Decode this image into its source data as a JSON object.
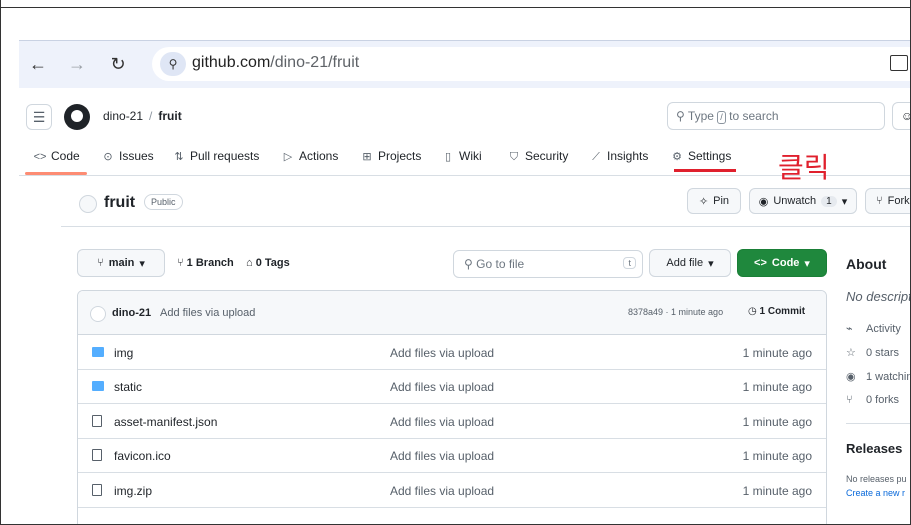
{
  "browser": {
    "url_host": "github.com",
    "url_path": "/dino-21/fruit"
  },
  "header": {
    "owner": "dino-21",
    "separator": "/",
    "repo": "fruit",
    "search_prefix": "Type",
    "search_key": "/",
    "search_suffix": "to search"
  },
  "tabs": [
    {
      "label": "Code",
      "icon": "<>"
    },
    {
      "label": "Issues",
      "icon": "⊙"
    },
    {
      "label": "Pull requests",
      "icon": "⇅"
    },
    {
      "label": "Actions",
      "icon": "▷"
    },
    {
      "label": "Projects",
      "icon": "⊞"
    },
    {
      "label": "Wiki",
      "icon": "▯"
    },
    {
      "label": "Security",
      "icon": "⛉"
    },
    {
      "label": "Insights",
      "icon": "⟋"
    },
    {
      "label": "Settings",
      "icon": "⚙"
    }
  ],
  "annotation": {
    "click_label": "클릭",
    "color": "#e0202d"
  },
  "repo": {
    "name": "fruit",
    "visibility": "Public",
    "pin_label": "Pin",
    "unwatch_label": "Unwatch",
    "watch_count": "1",
    "fork_label": "Fork"
  },
  "filenav": {
    "branch": "main",
    "branches": "1 Branch",
    "tags": "0 Tags",
    "goto_placeholder": "Go to file",
    "goto_key": "t",
    "add_file_label": "Add file",
    "code_label": "Code"
  },
  "commit": {
    "author": "dino-21",
    "message": "Add files via upload",
    "meta": "8378a49 · 1 minute ago",
    "count": "1 Commit"
  },
  "files": [
    {
      "name": "img",
      "type": "folder",
      "message": "Add files via upload",
      "time": "1 minute ago"
    },
    {
      "name": "static",
      "type": "folder",
      "message": "Add files via upload",
      "time": "1 minute ago"
    },
    {
      "name": "asset-manifest.json",
      "type": "file",
      "message": "Add files via upload",
      "time": "1 minute ago"
    },
    {
      "name": "favicon.ico",
      "type": "file",
      "message": "Add files via upload",
      "time": "1 minute ago"
    },
    {
      "name": "img.zip",
      "type": "file",
      "message": "Add files via upload",
      "time": "1 minute ago"
    }
  ],
  "about": {
    "title": "About",
    "description": "No descripti",
    "activity": "Activity",
    "stars": "0 stars",
    "watching": "1 watchin",
    "forks": "0 forks",
    "releases_title": "Releases",
    "releases_text": "No releases pu",
    "releases_link": "Create a new r"
  }
}
